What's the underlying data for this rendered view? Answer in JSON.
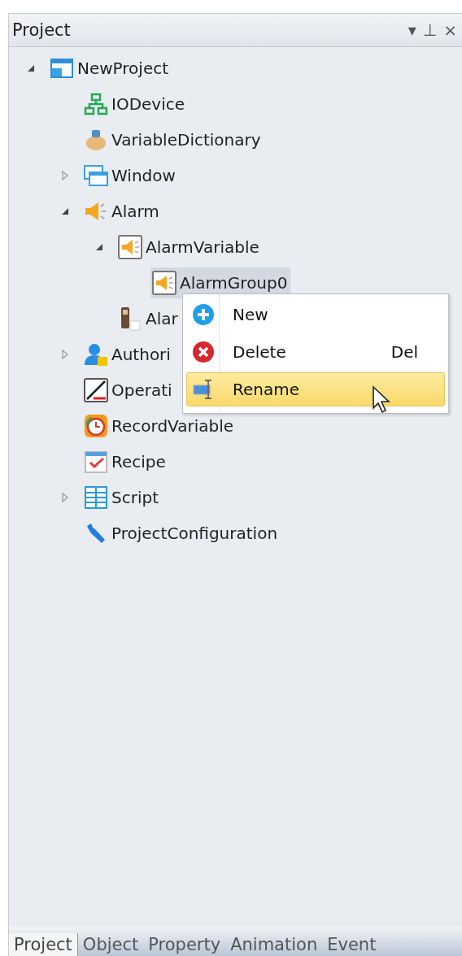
{
  "panel": {
    "title": "Project",
    "header_buttons": [
      "▾",
      "⊥",
      "×"
    ]
  },
  "tree": [
    {
      "label": "NewProject",
      "expanded": true,
      "selected": false,
      "children": [
        {
          "label": "IODevice",
          "selected": false
        },
        {
          "label": "VariableDictionary",
          "selected": false
        },
        {
          "label": "Window",
          "expanded": false,
          "selected": false
        },
        {
          "label": "Alarm",
          "expanded": true,
          "selected": false,
          "children": [
            {
              "label": "AlarmVariable",
              "expanded": true,
              "selected": false,
              "children": [
                {
                  "label": "AlarmGroup0",
                  "selected": true
                }
              ]
            },
            {
              "label": "Alar",
              "selected": false
            }
          ]
        },
        {
          "label": "Authori",
          "expanded": false,
          "selected": false
        },
        {
          "label": "Operati",
          "selected": false
        },
        {
          "label": "RecordVariable",
          "selected": false
        },
        {
          "label": "Recipe",
          "selected": false
        },
        {
          "label": "Script",
          "expanded": false,
          "selected": false
        },
        {
          "label": "ProjectConfiguration",
          "selected": false
        }
      ]
    }
  ],
  "context_menu": [
    {
      "label": "New",
      "selected": false
    },
    {
      "label": "Delete",
      "shortcut": "Del",
      "selected": false
    },
    {
      "label": "Rename",
      "selected": true
    }
  ],
  "bottom_tabs": [
    {
      "label": "Project",
      "selected": true
    },
    {
      "label": "Object",
      "selected": false
    },
    {
      "label": "Property",
      "selected": false
    },
    {
      "label": "Animation",
      "selected": false
    },
    {
      "label": "Event",
      "selected": false
    }
  ]
}
